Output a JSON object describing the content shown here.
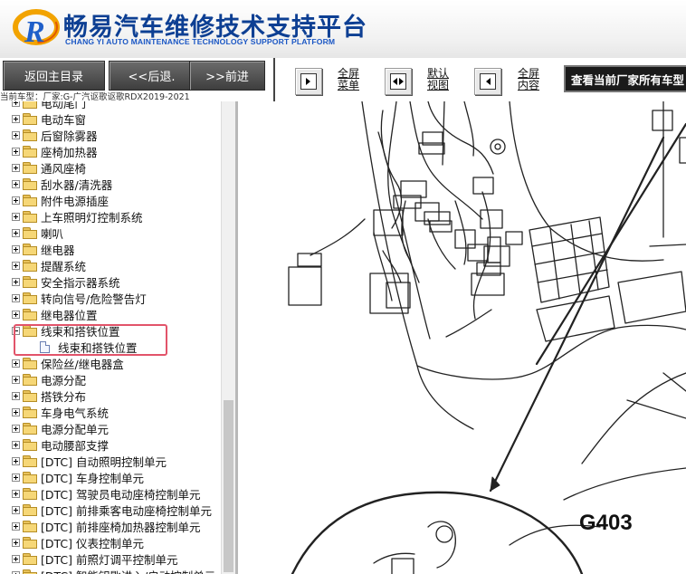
{
  "header": {
    "title_cn": "畅易汽车维修技术支持平台",
    "title_en": "CHANG YI AUTO MAINTENANCE TECHNOLOGY SUPPORT PLATFORM"
  },
  "toolbar": {
    "home_label": "返回主目录",
    "back_label": "<<后退.",
    "forward_label": ">>前进",
    "fullscreen_menu_label": [
      "全屏",
      "菜单"
    ],
    "default_view_label": [
      "默认",
      "视图"
    ],
    "fullscreen_content_label": [
      "全屏",
      "内容"
    ],
    "view_all_models_label": "查看当前厂家所有车型"
  },
  "current_model": "当前车型：厂家:G-广汽讴歌讴歌RDX2019-2021",
  "tree": {
    "items": [
      {
        "label": "电动尾门",
        "type": "folder"
      },
      {
        "label": "电动车窗",
        "type": "folder"
      },
      {
        "label": "后窗除雾器",
        "type": "folder"
      },
      {
        "label": "座椅加热器",
        "type": "folder"
      },
      {
        "label": "通风座椅",
        "type": "folder"
      },
      {
        "label": "刮水器/清洗器",
        "type": "folder"
      },
      {
        "label": "附件电源插座",
        "type": "folder"
      },
      {
        "label": "上车照明灯控制系统",
        "type": "folder"
      },
      {
        "label": "喇叭",
        "type": "folder"
      },
      {
        "label": "继电器",
        "type": "folder"
      },
      {
        "label": "提醒系统",
        "type": "folder"
      },
      {
        "label": "安全指示器系统",
        "type": "folder"
      },
      {
        "label": "转向信号/危险警告灯",
        "type": "folder"
      },
      {
        "label": "继电器位置",
        "type": "folder"
      },
      {
        "label": "线束和搭铁位置",
        "type": "folder-open"
      },
      {
        "label": "线束和搭铁位置",
        "type": "doc"
      },
      {
        "label": "保险丝/继电器盒",
        "type": "folder"
      },
      {
        "label": "电源分配",
        "type": "folder"
      },
      {
        "label": "搭铁分布",
        "type": "folder"
      },
      {
        "label": "车身电气系统",
        "type": "folder"
      },
      {
        "label": "电源分配单元",
        "type": "folder"
      },
      {
        "label": "电动腰部支撑",
        "type": "folder"
      },
      {
        "label": "[DTC] 自动照明控制单元",
        "type": "folder"
      },
      {
        "label": "[DTC] 车身控制单元",
        "type": "folder"
      },
      {
        "label": "[DTC] 驾驶员电动座椅控制单元",
        "type": "folder"
      },
      {
        "label": "[DTC] 前排乘客电动座椅控制单元",
        "type": "folder"
      },
      {
        "label": "[DTC] 前排座椅加热器控制单元",
        "type": "folder"
      },
      {
        "label": "[DTC] 仪表控制单元",
        "type": "folder"
      },
      {
        "label": "[DTC] 前照灯调平控制单元",
        "type": "folder"
      },
      {
        "label": "[DTC] 智能钥匙进入/启动控制单元",
        "type": "folder"
      }
    ]
  },
  "diagram": {
    "ground_label": "G403"
  }
}
